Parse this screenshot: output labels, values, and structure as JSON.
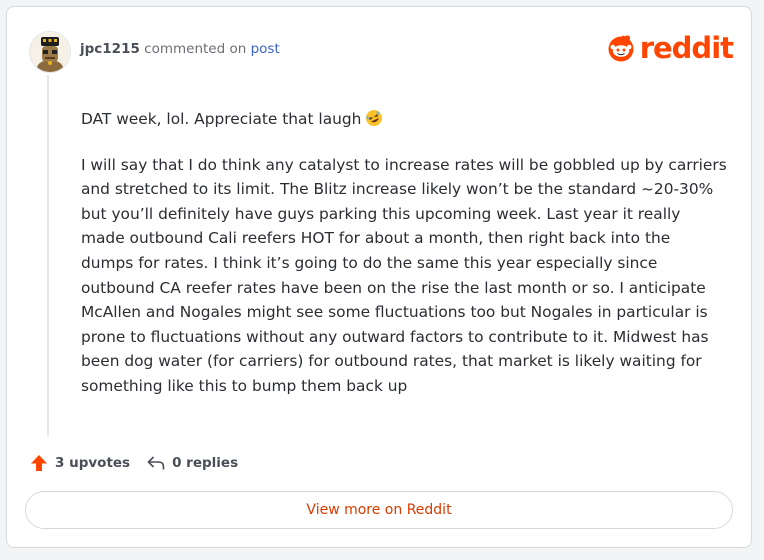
{
  "comment": {
    "username": "jpc1215",
    "action_text": "commented on",
    "post_link": "post",
    "paragraphs": [
      "DAT week, lol. Appreciate that laugh",
      "I will say that I do think any catalyst to increase rates will be gobbled up by carriers and stretched to its limit. The Blitz increase likely won’t be the standard ~20-30% but you’ll definitely have guys parking this upcoming week. Last year it really made outbound Cali reefers HOT for about a month, then right back into the dumps for rates. I think it’s going to do the same this year especially since outbound CA reefer rates have been on the rise the last month or so. I anticipate McAllen and Nogales might see some fluctuations too but Nogales in particular is prone to fluctuations without any outward factors to contribute to it. Midwest has been dog water (for carriers) for outbound rates, that market is likely waiting for something like this to bump them back up"
    ],
    "emoji": "rofl-emoji"
  },
  "brand": {
    "name": "reddit",
    "color": "#ff4500"
  },
  "actions": {
    "upvotes_label": "3 upvotes",
    "replies_label": "0 replies"
  },
  "footer": {
    "view_more_label": "View more on Reddit"
  },
  "icons": [
    "avatar",
    "reddit-logo-icon",
    "upvote-arrow-icon",
    "reply-icon",
    "rofl-emoji"
  ]
}
